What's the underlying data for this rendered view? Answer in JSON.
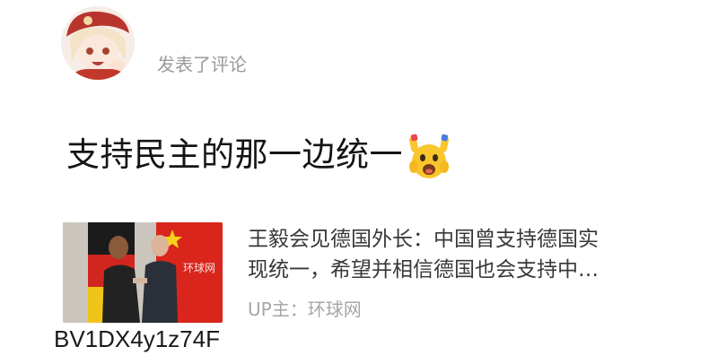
{
  "post": {
    "action": "发表了评论",
    "comment": "支持民主的那一边统一"
  },
  "card": {
    "title_line1": "王毅会见德国外长：中国曾支持德国实",
    "title_line2": "现统一，希望并相信德国也会支持中…",
    "up_label": "UP主：",
    "up_name": "环球网",
    "thumb_watermark": "环球网"
  },
  "bv_id": "BV1DX4y1z74F"
}
